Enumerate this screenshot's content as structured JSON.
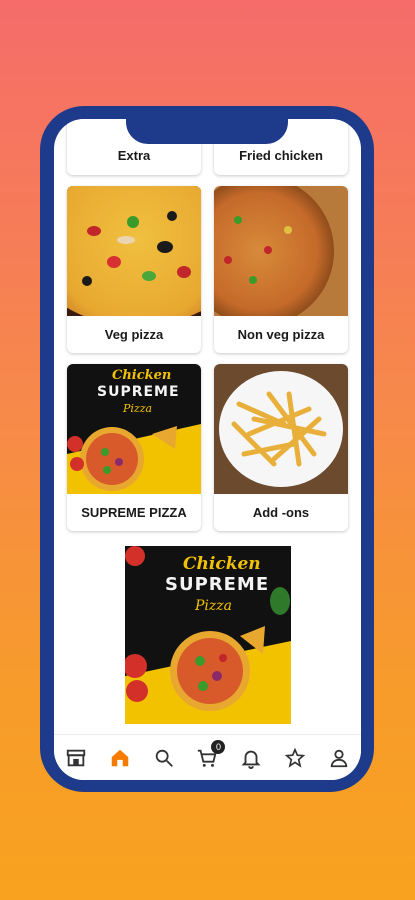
{
  "categories_top": [
    "Extra",
    "Fried chicken"
  ],
  "categories": [
    {
      "label": "Veg pizza"
    },
    {
      "label": "Non veg pizza"
    },
    {
      "label": "SUPREME PIZZA"
    },
    {
      "label": "Add -ons"
    }
  ],
  "poster": {
    "line1": "Chicken",
    "line2": "SUPREME",
    "line3": "Pizza"
  },
  "nav": {
    "items": [
      "store-icon",
      "home-icon",
      "search-icon",
      "cart-icon",
      "bell-icon",
      "star-icon",
      "user-icon"
    ],
    "active": "home-icon",
    "cart_count": "0"
  },
  "colors": {
    "accent": "#f57c00",
    "frame": "#1e3a8a"
  }
}
